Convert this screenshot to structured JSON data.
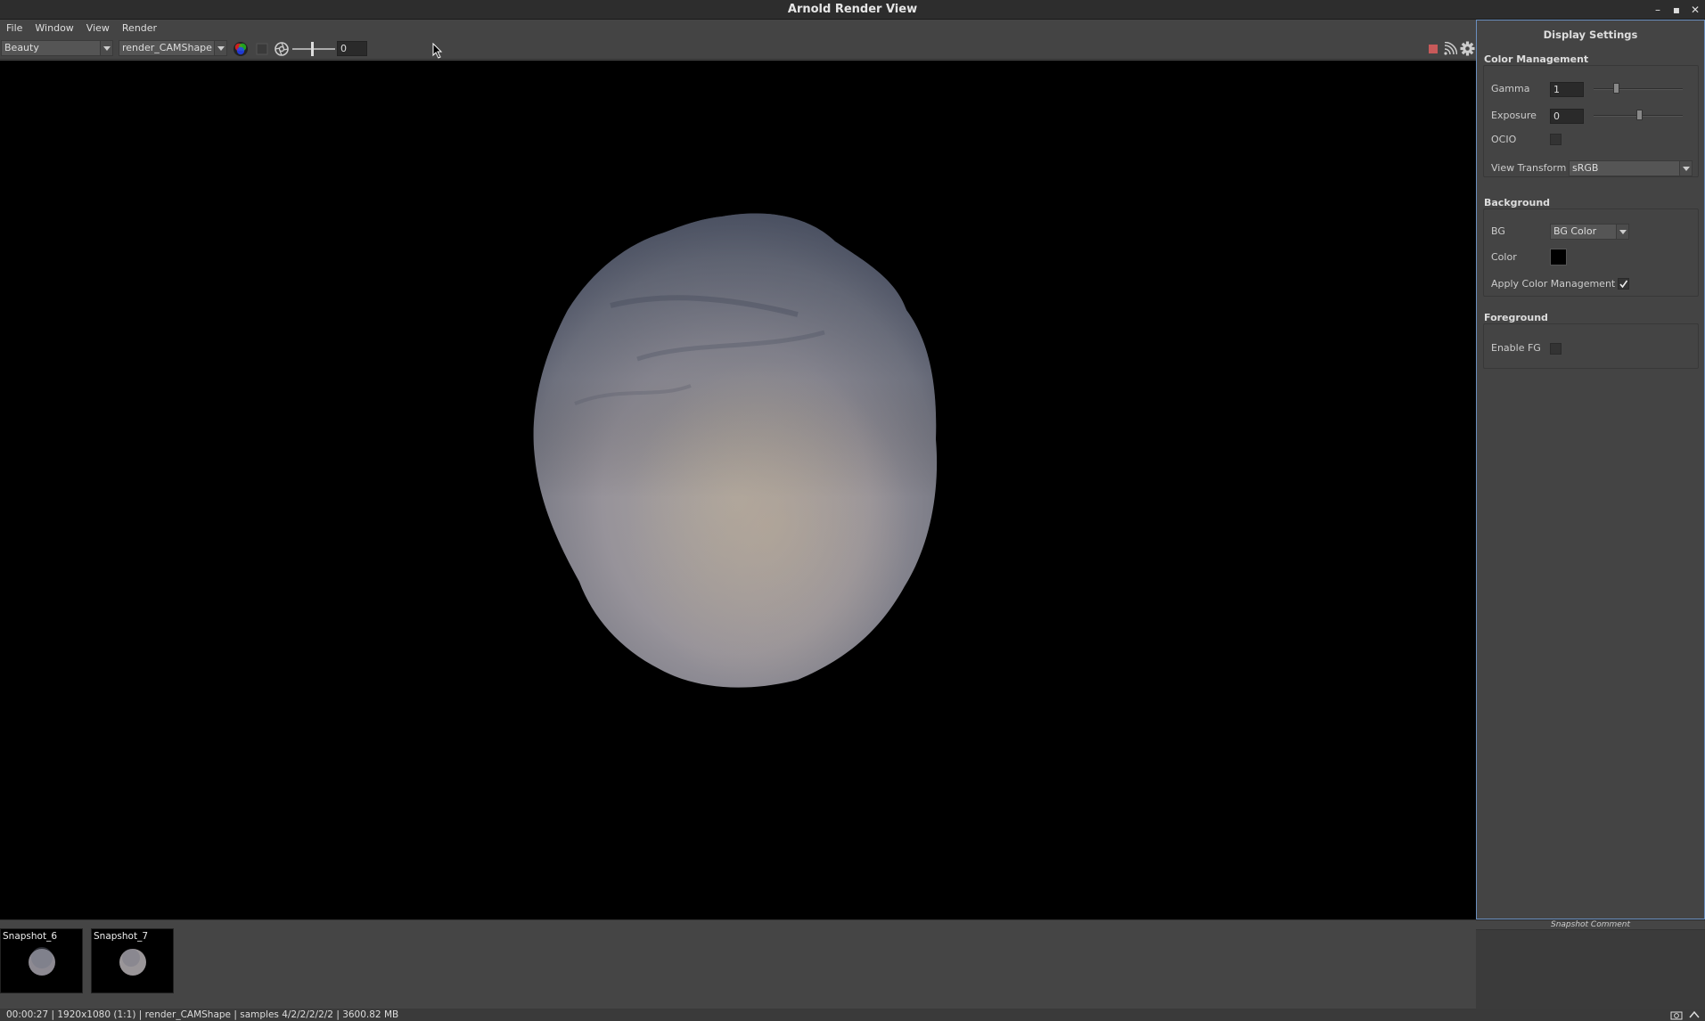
{
  "window": {
    "title": "Arnold Render View",
    "controls": [
      "minimize-icon",
      "maximize-icon",
      "close-icon"
    ]
  },
  "menu": [
    "File",
    "Window",
    "View",
    "Render"
  ],
  "toolbar": {
    "aov": "Beauty",
    "camera": "render_CAMShape",
    "exposure_value": "0",
    "icons": [
      "color-channels-icon",
      "region-icon",
      "aperture-icon",
      "stop-render-icon",
      "ipr-icon",
      "settings-gear-icon"
    ]
  },
  "display_settings": {
    "title": "Display Settings",
    "color_management": {
      "title": "Color Management",
      "gamma_label": "Gamma",
      "gamma": "1",
      "exposure_label": "Exposure",
      "exposure": "0",
      "ocio_label": "OCIO",
      "ocio": false,
      "view_transform_label": "View Transform",
      "view_transform": "sRGB"
    },
    "background": {
      "title": "Background",
      "bg_label": "BG",
      "bg": "BG Color",
      "color_label": "Color",
      "color": "#000000",
      "apply_cm_label": "Apply Color Management",
      "apply_cm": true
    },
    "foreground": {
      "title": "Foreground",
      "enable_fg_label": "Enable FG",
      "enable_fg": false
    }
  },
  "snapshots": [
    {
      "label": "Snapshot_6"
    },
    {
      "label": "Snapshot_7"
    }
  ],
  "snapshot_comment_label": "Snapshot Comment",
  "status": "00:00:27 | 1920x1080 (1:1) | render_CAMShape  | samples 4/2/2/2/2/2 | 3600.82 MB"
}
